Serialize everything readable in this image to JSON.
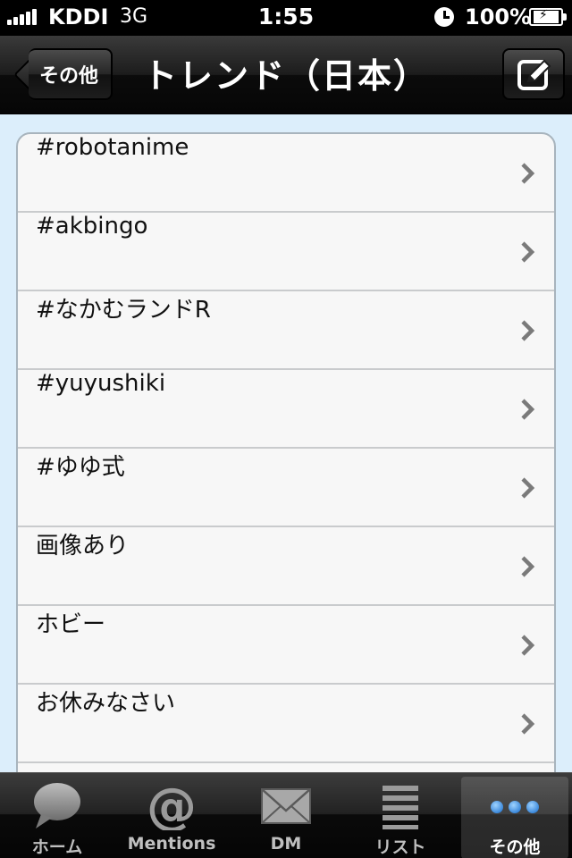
{
  "status_bar": {
    "carrier": "KDDI",
    "network": "3G",
    "time": "1:55",
    "battery_percent": "100%",
    "signal_bars": 5
  },
  "nav": {
    "back_label": "その他",
    "title": "トレンド（日本）",
    "compose_icon": "compose-icon"
  },
  "trends": [
    {
      "label": "#robotanime"
    },
    {
      "label": "#akbingo"
    },
    {
      "label": "#なかむランドR"
    },
    {
      "label": "#yuyushiki"
    },
    {
      "label": "#ゆゆ式"
    },
    {
      "label": "画像あり"
    },
    {
      "label": "ホビー"
    },
    {
      "label": "お休みなさい"
    }
  ],
  "tabs": [
    {
      "label": "ホーム",
      "icon": "speech-bubble-icon"
    },
    {
      "label": "Mentions",
      "icon": "at-sign-icon"
    },
    {
      "label": "DM",
      "icon": "envelope-icon"
    },
    {
      "label": "リスト",
      "icon": "list-icon"
    },
    {
      "label": "その他",
      "icon": "more-dots-icon"
    }
  ],
  "active_tab": 4,
  "colors": {
    "content_bg": "#dceefb",
    "accent_blue": "#3a8fe0",
    "active_tab_text": "#ffffff"
  }
}
